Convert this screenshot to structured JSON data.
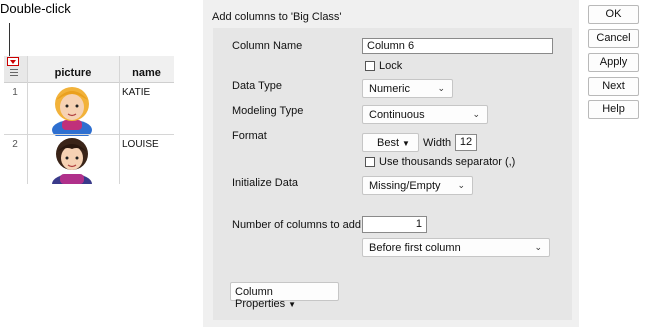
{
  "callout": {
    "text": "Double-click"
  },
  "table": {
    "columns": [
      "picture",
      "name"
    ],
    "rows": [
      {
        "num": "1",
        "name": "KATIE"
      },
      {
        "num": "2",
        "name": "LOUISE"
      }
    ]
  },
  "dialog": {
    "title": "Add columns to 'Big Class'",
    "column_name_label": "Column Name",
    "column_name_value": "Column 6",
    "lock_label": "Lock",
    "data_type_label": "Data Type",
    "data_type_value": "Numeric",
    "modeling_type_label": "Modeling Type",
    "modeling_type_value": "Continuous",
    "format_label": "Format",
    "format_value": "Best",
    "width_label": "Width",
    "width_value": "12",
    "thousands_label": "Use thousands separator (,)",
    "initialize_label": "Initialize Data",
    "initialize_value": "Missing/Empty",
    "num_columns_label": "Number of columns to add",
    "num_columns_value": "1",
    "position_value": "Before first column",
    "column_properties_label": "Column Properties"
  },
  "buttons": {
    "ok": "OK",
    "cancel": "Cancel",
    "apply": "Apply",
    "next": "Next",
    "help": "Help"
  },
  "colors": {
    "dialog_bg": "#f0f0f0",
    "panel_bg": "#e6e6e6",
    "corner_marker": "#cc0000"
  }
}
